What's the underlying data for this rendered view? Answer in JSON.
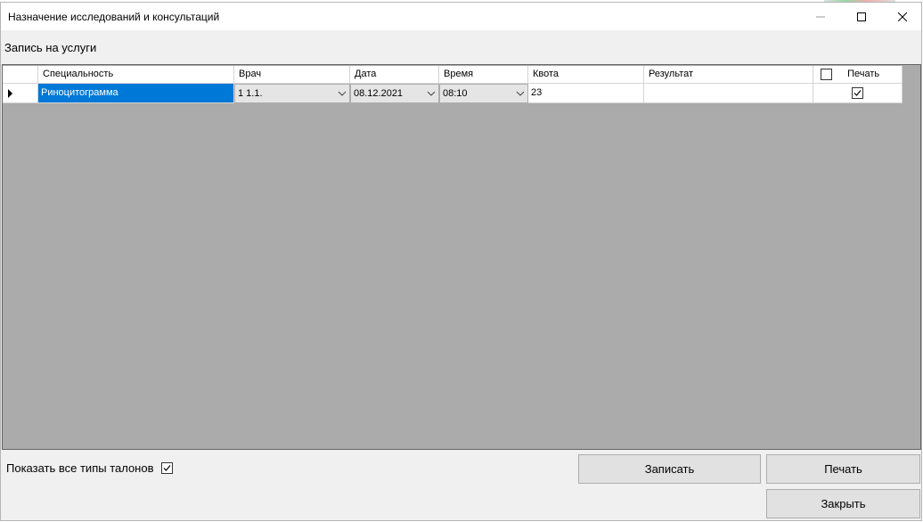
{
  "window": {
    "title": "Назначение исследований и консультаций",
    "subtitle": "Запись на услуги"
  },
  "grid": {
    "columns": [
      "Специальность",
      "Врач",
      "Дата",
      "Время",
      "Квота",
      "Результат",
      "Печать"
    ],
    "rows": [
      {
        "speciality": "Риноцитограмма",
        "doctor": "1 1.1.",
        "date": "08.12.2021",
        "time": "08:10",
        "quota": "23",
        "result": "",
        "print": true
      }
    ],
    "header_print_all_checked": false
  },
  "footer": {
    "show_all_label": "Показать все типы талонов",
    "show_all_checked": true,
    "save_button": "Записать",
    "print_button": "Печать",
    "close_button": "Закрыть"
  },
  "colors": {
    "selection": "#0078d7",
    "grid_background": "#ababab",
    "window_background": "#f0f0f0"
  },
  "icons": [
    "minimize-icon",
    "maximize-icon",
    "close-icon",
    "row-pointer-icon",
    "chevron-down-icon",
    "checkmark-icon"
  ]
}
